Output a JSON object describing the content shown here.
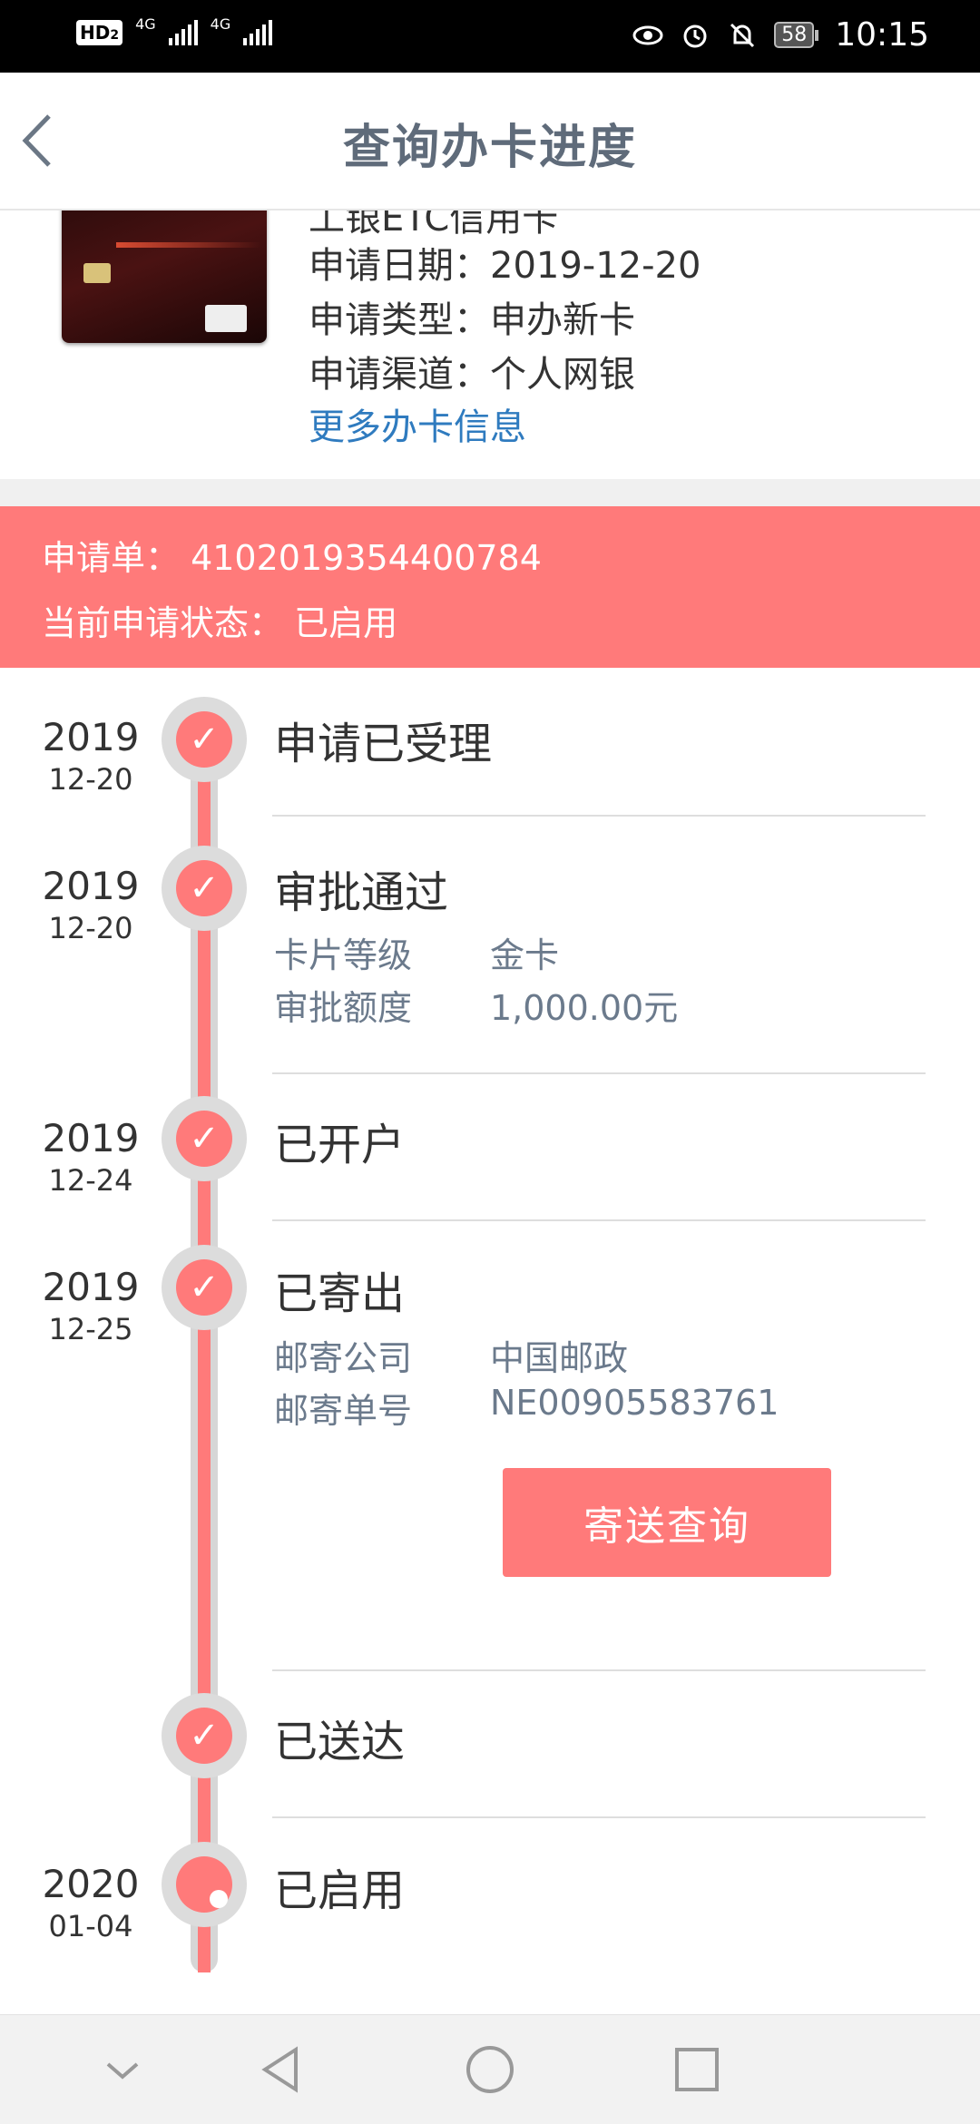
{
  "status_bar": {
    "hd": "HD",
    "hd_sub": "2",
    "net1": "4G",
    "net2": "4G",
    "battery": "58",
    "time": "10:15"
  },
  "header": {
    "title": "查询办卡进度"
  },
  "card": {
    "name": "工银ETC信用卡",
    "apply_date": "申请日期：2019-12-20",
    "apply_type": "申请类型：申办新卡",
    "apply_channel": "申请渠道：个人网银",
    "more_link": "更多办卡信息"
  },
  "banner": {
    "order": "申请单：  4102019354400784",
    "status": "当前申请状态：  已启用"
  },
  "timeline": {
    "steps": [
      {
        "year": "2019",
        "md": "12-20",
        "label": "申请已受理"
      },
      {
        "year": "2019",
        "md": "12-20",
        "label": "审批通过",
        "details": [
          {
            "k": "卡片等级",
            "v": "金卡"
          },
          {
            "k": "审批额度",
            "v": "1,000.00元"
          }
        ]
      },
      {
        "year": "2019",
        "md": "12-24",
        "label": "已开户"
      },
      {
        "year": "2019",
        "md": "12-25",
        "label": "已寄出",
        "details": [
          {
            "k": "邮寄公司",
            "v": "中国邮政"
          },
          {
            "k": "邮寄单号",
            "v": "NE00905583761"
          }
        ]
      },
      {
        "year": "",
        "md": "",
        "label": "已送达"
      },
      {
        "year": "2020",
        "md": "01-04",
        "label": "已启用"
      }
    ],
    "track_button": "寄送查询"
  },
  "colors": {
    "accent": "#ff7a7a",
    "title": "#5f6b7a",
    "link": "#2f7bbf"
  }
}
